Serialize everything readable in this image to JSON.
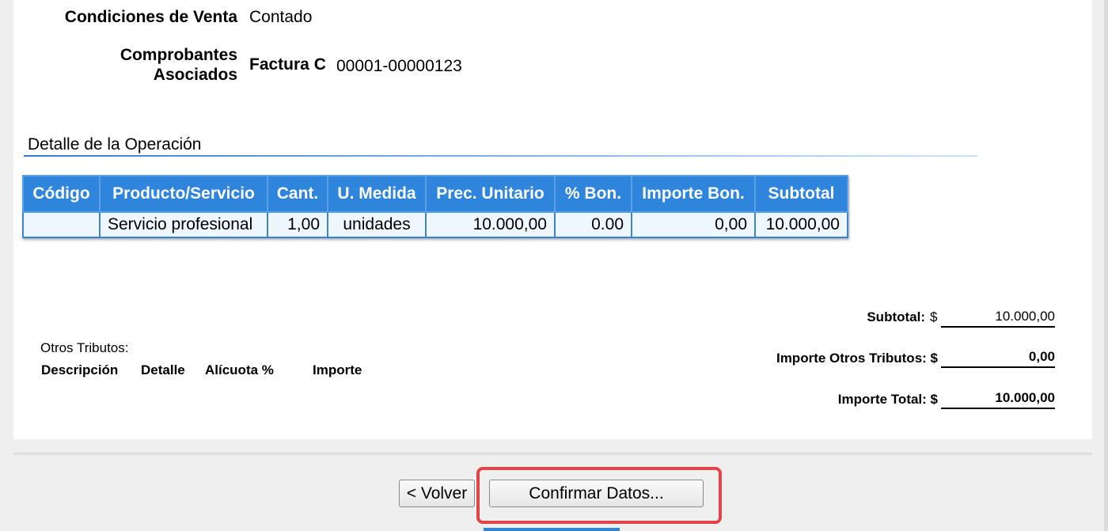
{
  "header_fields": {
    "condiciones_label": "Condiciones de Venta",
    "condiciones_value": "Contado",
    "comprobantes_label_line1": "Comprobantes",
    "comprobantes_label_line2": "Asociados",
    "comprobante_tipo": "Factura C",
    "comprobante_numero": "00001-00000123"
  },
  "detalle": {
    "title": "Detalle de la Operación",
    "columns": [
      "Código",
      "Producto/Servicio",
      "Cant.",
      "U. Medida",
      "Prec. Unitario",
      "% Bon.",
      "Importe Bon.",
      "Subtotal"
    ],
    "rows": [
      [
        "",
        "Servicio profesional",
        "1,00",
        "unidades",
        "10.000,00",
        "0.00",
        "0,00",
        "10.000,00"
      ]
    ]
  },
  "otros_tributos": {
    "title": "Otros Tributos:",
    "columns": [
      "Descripción",
      "Detalle",
      "Alícuota %",
      "Importe"
    ]
  },
  "totales": {
    "subtotal_label": "Subtotal: ",
    "subtotal_currency": "$",
    "subtotal_value": "10.000,00",
    "otros_label": "Importe Otros Tributos: $",
    "otros_value": "0,00",
    "total_label": "Importe Total: $",
    "total_value": "10.000,00"
  },
  "actions": {
    "volver_label": "< Volver",
    "confirmar_label": "Confirmar Datos..."
  },
  "colors": {
    "table_header": "#2f84dc",
    "table_cell": "#eef6fe",
    "highlight": "#e0454a"
  }
}
